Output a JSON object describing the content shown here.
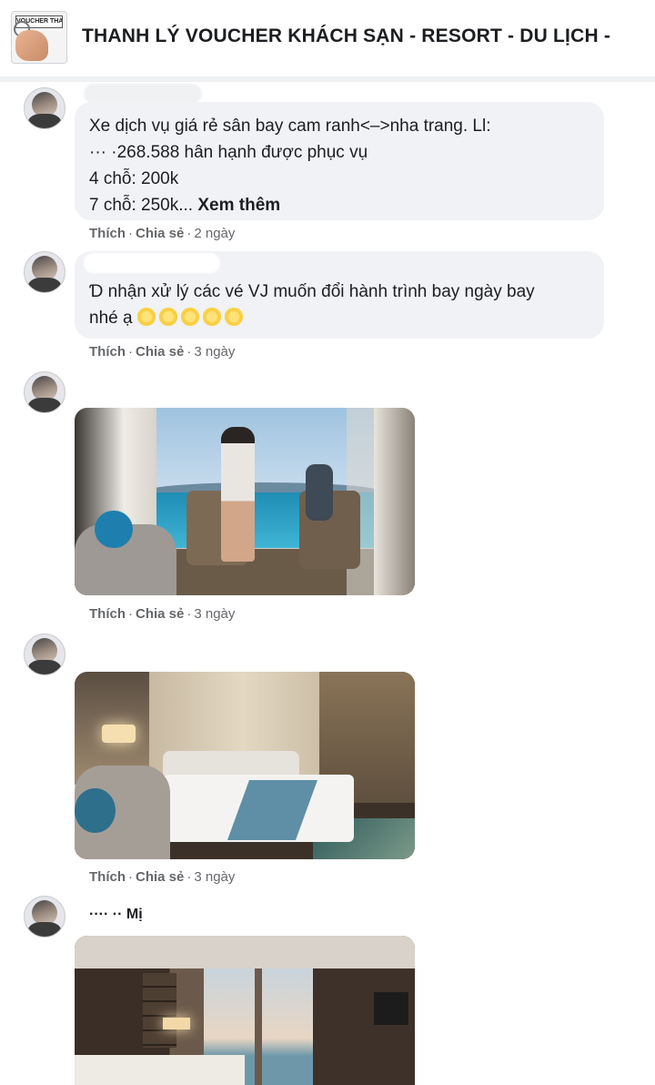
{
  "group": {
    "title": "THANH LÝ VOUCHER KHÁCH SẠN - RESORT - DU LỊCH -",
    "thumb_text": "VOUCHER THANH LÝ"
  },
  "comments": [
    {
      "lines": [
        "Xe dịch vụ giá rẻ sân bay cam ranh<–>nha trang. Ll:",
        "··· ·268.588 hân hạnh được phục vụ",
        "4 chỗ: 200k",
        "7 chỗ: 250k..."
      ],
      "see_more": "Xem thêm",
      "like": "Thích",
      "share": "Chia sẻ",
      "time": "2 ngày"
    },
    {
      "lines": [
        "Ɗ nhận xử lý các vé VJ muốn đổi hành trình bay ngày bay",
        "nhé ạ"
      ],
      "emoji_count": 5,
      "like": "Thích",
      "share": "Chia sẻ",
      "time": "3 ngày"
    },
    {
      "like": "Thích",
      "share": "Chia sẻ",
      "time": "3 ngày"
    },
    {
      "like": "Thích",
      "share": "Chia sẻ",
      "time": "3 ngày"
    },
    {
      "author_partial": "···· ·· Mị"
    }
  ],
  "icons": {
    "emoji": "sun-face-emoji"
  },
  "colors": {
    "bubble_bg": "#f0f2f5",
    "meta_text": "#65676b"
  }
}
